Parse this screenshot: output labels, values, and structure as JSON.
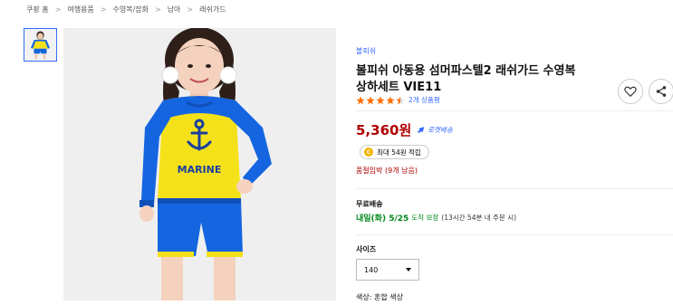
{
  "breadcrumb": [
    "쿠팡 홈",
    "여행용품",
    "수영복/잡화",
    "남아",
    "래쉬가드"
  ],
  "breadcrumb_separator": ">",
  "product": {
    "brand": "볼피쉬",
    "title_line1": "볼피쉬 아동용 섬머파스텔2 래쉬가드 수영복",
    "title_line2": "상하세트 VIE11",
    "rating": 4.5,
    "review_count": "2개 상품평",
    "price": "5,360원",
    "rocket_label": "로켓배송",
    "points": "최대 54원 적립",
    "coin_glyph": "C",
    "stock_notice": "품절임박 (9개 남음)",
    "shipping": {
      "label": "무료배송",
      "day": "내일(화) 5/25",
      "guarantee": "도착 보장",
      "cutoff": "(13시간 54분 내 주문 시)"
    },
    "size": {
      "label": "사이즈",
      "selected": "140"
    },
    "color_line": "색상: 혼합 색상",
    "image_print": "MARINE"
  },
  "icons": {
    "heart": "heart-icon",
    "share": "share-icon",
    "rocket": "rocket-icon",
    "star": "star-icon"
  },
  "colors": {
    "accent": "#346aff",
    "price": "#ae0000",
    "shipping": "#00891a",
    "star": "#ff6f00",
    "suit_blue": "#1565e0",
    "suit_yellow": "#f4e11a"
  }
}
